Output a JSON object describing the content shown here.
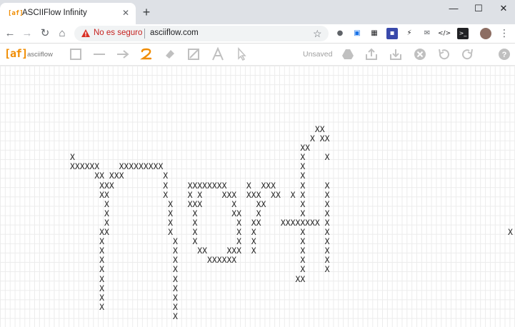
{
  "browser": {
    "tab": {
      "favicon": "[af]",
      "title": "ASCIIFlow Infinity",
      "close": "✕"
    },
    "new_tab": "+",
    "window_controls": {
      "minimize": "—",
      "maximize": "☐",
      "close": "✕"
    },
    "nav": {
      "back": "←",
      "forward": "→",
      "reload": "↻",
      "home": "⌂"
    },
    "address": {
      "security_text": "No es seguro",
      "url": "asciiflow.com"
    },
    "bookmark_star": "☆",
    "menu": "⋮"
  },
  "app": {
    "logo": "[af]",
    "name": "asciiflow",
    "tools": [
      "box-tool-icon",
      "line-tool-icon",
      "arrow-tool-icon",
      "freeform-tool-icon",
      "erase-tool-icon",
      "resize-tool-icon",
      "text-tool-icon",
      "select-tool-icon"
    ],
    "status": "Unsaved",
    "actions": [
      "drive-icon",
      "export-icon",
      "import-icon",
      "clear-icon",
      "undo-icon",
      "redo-icon",
      "help-icon"
    ],
    "accent_color": "#f08c00"
  },
  "canvas": {
    "drawing": "                                                  XX\n                                                 X XX\n                                               XX\nX                                              X    X\nXXXXXX    XXXXXXXXX                            X\n     XX XXX        X                           X\n      XXX          X    XXXXXXXX    X  XXX     X    X\n      XX           X    X X    XXX  XXX  XX  X X    X\n       X            X   XXX      X    XX       X    X\n       X            X    X       XX   X        X    X\n       X            X    X        X  XX    XXXXXXXX X\n      XX            X    X        X  X         X    X\n      X              X   X        X  X         X    X\n      X              X    XX    XXX  X         X    X\n      X              X      XXXXXX             X    X\n      X              X                         X    X\n      X              X                        XX\n      X              X\n      X              X\n      X              X\n                     X",
    "stray_char": "X"
  }
}
